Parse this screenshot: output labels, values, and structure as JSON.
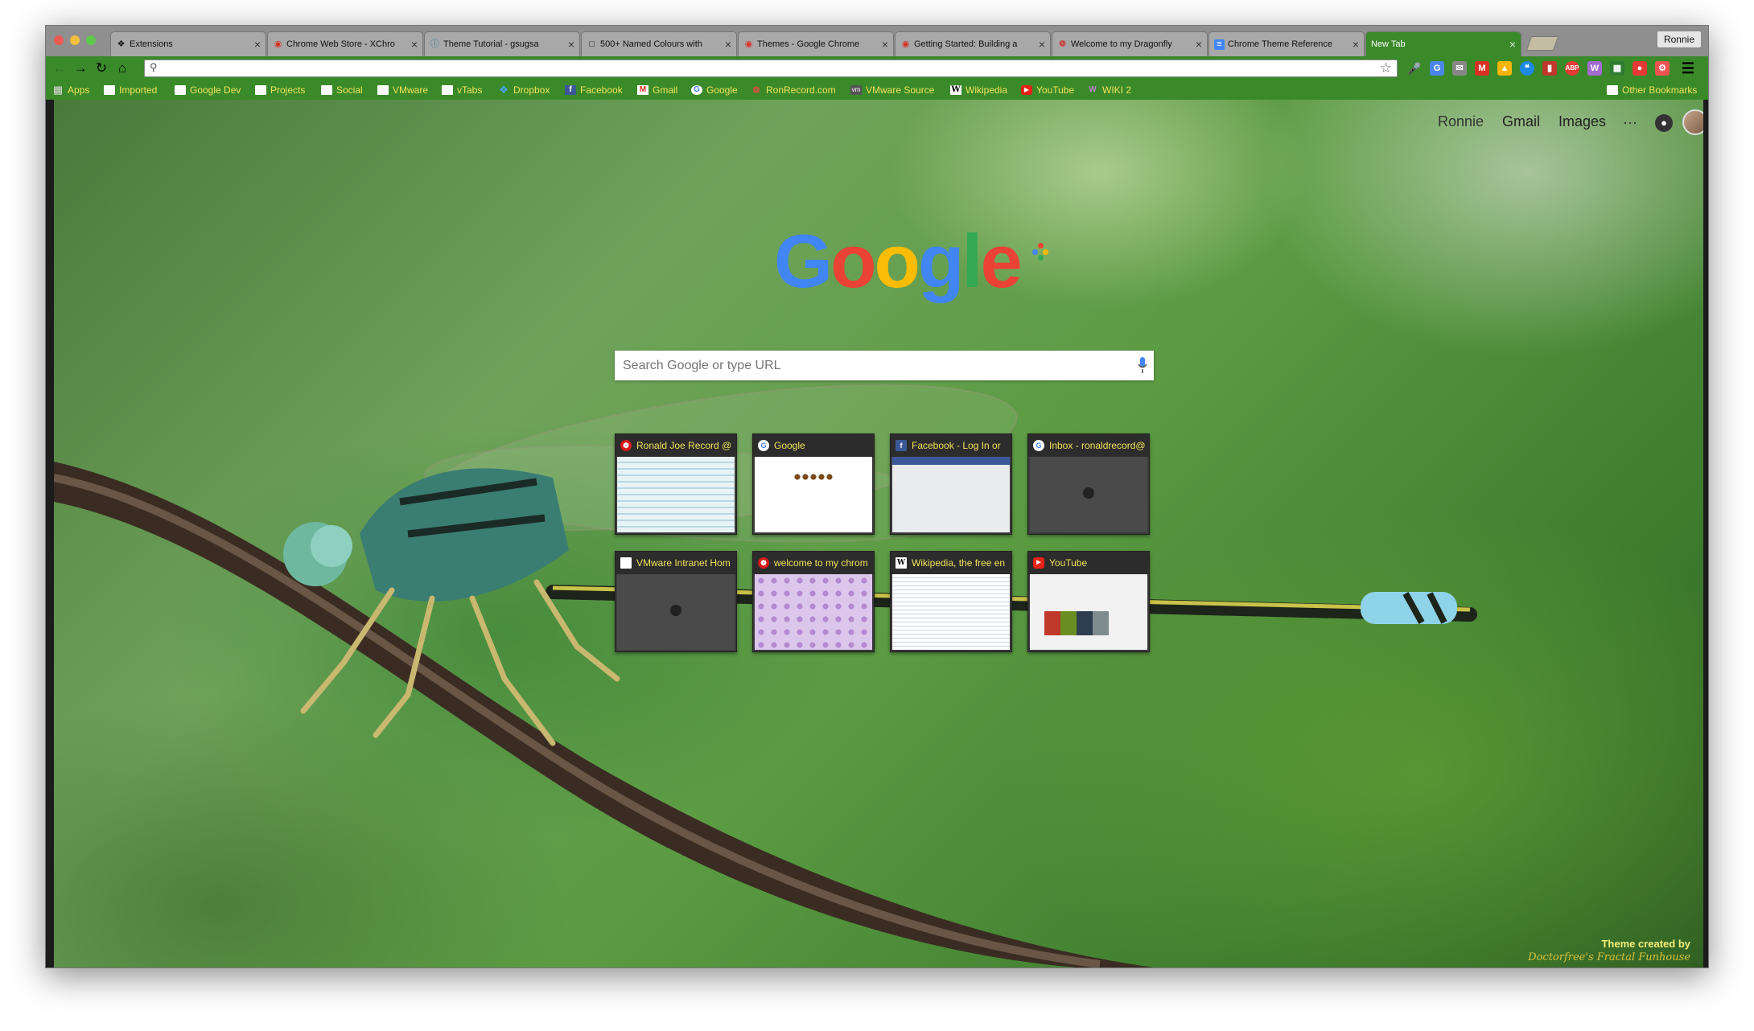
{
  "browser": {
    "profile_name": "Ronnie",
    "tabs": [
      {
        "title": "Extensions",
        "icon": "puzzle-icon"
      },
      {
        "title": "Chrome Web Store - XChro",
        "icon": "chrome-icon"
      },
      {
        "title": "Theme Tutorial - gsugsa",
        "icon": "wordpress-icon"
      },
      {
        "title": "500+ Named Colours with",
        "icon": "page-icon"
      },
      {
        "title": "Themes - Google Chrome",
        "icon": "chrome-icon"
      },
      {
        "title": "Getting Started: Building a",
        "icon": "chrome-icon"
      },
      {
        "title": "Welcome to my Dragonfly",
        "icon": "dragonfly-icon"
      },
      {
        "title": "Chrome Theme Reference",
        "icon": "docs-icon"
      },
      {
        "title": "New Tab",
        "icon": ""
      }
    ],
    "omnibox": {
      "value": "",
      "placeholder": ""
    }
  },
  "bookmarks": [
    {
      "label": "Apps",
      "icon": "apps-icon"
    },
    {
      "label": "Imported",
      "icon": "folder-icon"
    },
    {
      "label": "Google Dev",
      "icon": "folder-icon"
    },
    {
      "label": "Projects",
      "icon": "folder-icon"
    },
    {
      "label": "Social",
      "icon": "folder-icon"
    },
    {
      "label": "VMware",
      "icon": "folder-icon"
    },
    {
      "label": "vTabs",
      "icon": "folder-icon"
    },
    {
      "label": "Dropbox",
      "icon": "dropbox-icon"
    },
    {
      "label": "Facebook",
      "icon": "facebook-icon"
    },
    {
      "label": "Gmail",
      "icon": "gmail-icon"
    },
    {
      "label": "Google",
      "icon": "google-icon"
    },
    {
      "label": "RonRecord.com",
      "icon": "dragonfly-icon"
    },
    {
      "label": "VMware Source",
      "icon": "vmware-icon"
    },
    {
      "label": "Wikipedia",
      "icon": "wikipedia-icon"
    },
    {
      "label": "YouTube",
      "icon": "youtube-icon"
    },
    {
      "label": "WIKI 2",
      "icon": "wiki2-icon"
    },
    {
      "label": "Other Bookmarks",
      "icon": "folder-icon"
    }
  ],
  "newtab": {
    "user_name": "Ronnie",
    "gmail_label": "Gmail",
    "images_label": "Images",
    "logo_text": "Google",
    "search_placeholder": "Search Google or type URL",
    "tiles": [
      {
        "title": "Ronald Joe Record @",
        "icon": "dragonfly-icon"
      },
      {
        "title": "Google",
        "icon": "google-icon"
      },
      {
        "title": "Facebook - Log In or",
        "icon": "facebook-icon"
      },
      {
        "title": "Inbox - ronaldrecord@",
        "icon": "google-icon"
      },
      {
        "title": "VMware Intranet Hom",
        "icon": "page-icon"
      },
      {
        "title": "welcome to my chrom",
        "icon": "dragonfly-icon"
      },
      {
        "title": "Wikipedia, the free en",
        "icon": "wikipedia-icon"
      },
      {
        "title": "YouTube",
        "icon": "youtube-icon"
      }
    ],
    "credit_line1": "Theme created by",
    "credit_line2": "Doctorfree's Fractal Funhouse"
  },
  "colors": {
    "theme_frame": "#8f8f8f",
    "theme_toolbar": "#3a8a2a",
    "bookmark_text": "#f1e35a",
    "google_blue": "#4285f4",
    "google_red": "#ea4335",
    "google_yellow": "#fbbc05",
    "google_green": "#34a853"
  }
}
